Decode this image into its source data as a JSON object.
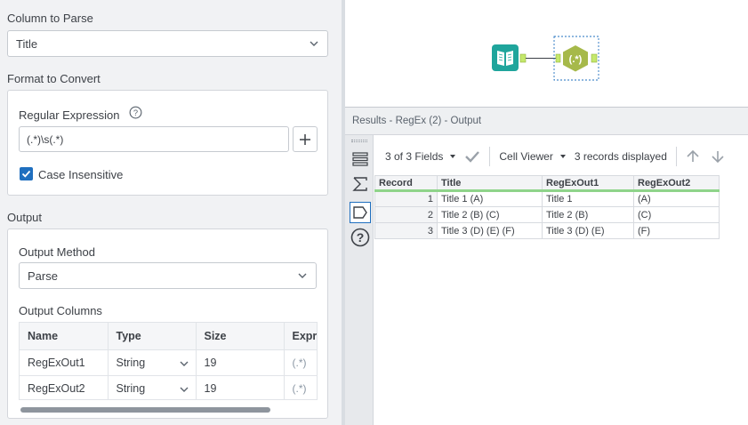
{
  "config": {
    "column_to_parse": {
      "title": "Column to Parse",
      "value": "Title"
    },
    "format_to_convert": {
      "title": "Format to Convert",
      "regex_label": "Regular Expression",
      "regex_value": "(.*)\\s(.*)",
      "case_insensitive_label": "Case Insensitive",
      "case_insensitive_checked": true
    },
    "output": {
      "title": "Output",
      "method_label": "Output Method",
      "method_value": "Parse",
      "columns_label": "Output Columns",
      "columns_headers": [
        "Name",
        "Type",
        "Size",
        "Expre"
      ],
      "columns_rows": [
        {
          "name": "RegExOut1",
          "type": "String",
          "size": "19",
          "expr": "(.*)"
        },
        {
          "name": "RegExOut2",
          "type": "String",
          "size": "19",
          "expr": "(.*)"
        }
      ]
    }
  },
  "results": {
    "header": "Results - RegEx (2) - Output",
    "toolbar": {
      "fields": "3 of 3 Fields",
      "viewer": "Cell Viewer",
      "records": "3 records displayed"
    },
    "grid": {
      "headers": [
        "Record",
        "Title",
        "RegExOut1",
        "RegExOut2"
      ],
      "rows": [
        [
          "1",
          "Title 1 (A)",
          "Title 1",
          "(A)"
        ],
        [
          "2",
          "Title 2 (B) (C)",
          "Title 2 (B)",
          "(C)"
        ],
        [
          "3",
          "Title 3 (D) (E) (F)",
          "Title 3 (D) (E)",
          "(F)"
        ]
      ]
    }
  },
  "icons": {
    "input_tool": "book-icon",
    "regex_tool": "regex-hexagon-icon",
    "regex_tool_label": "(.*)"
  },
  "colors": {
    "input_tool": "#1fa59c",
    "regex_tool": "#a6b94a",
    "accent": "#1f6fbf",
    "header_underline": "#8fd48a"
  }
}
